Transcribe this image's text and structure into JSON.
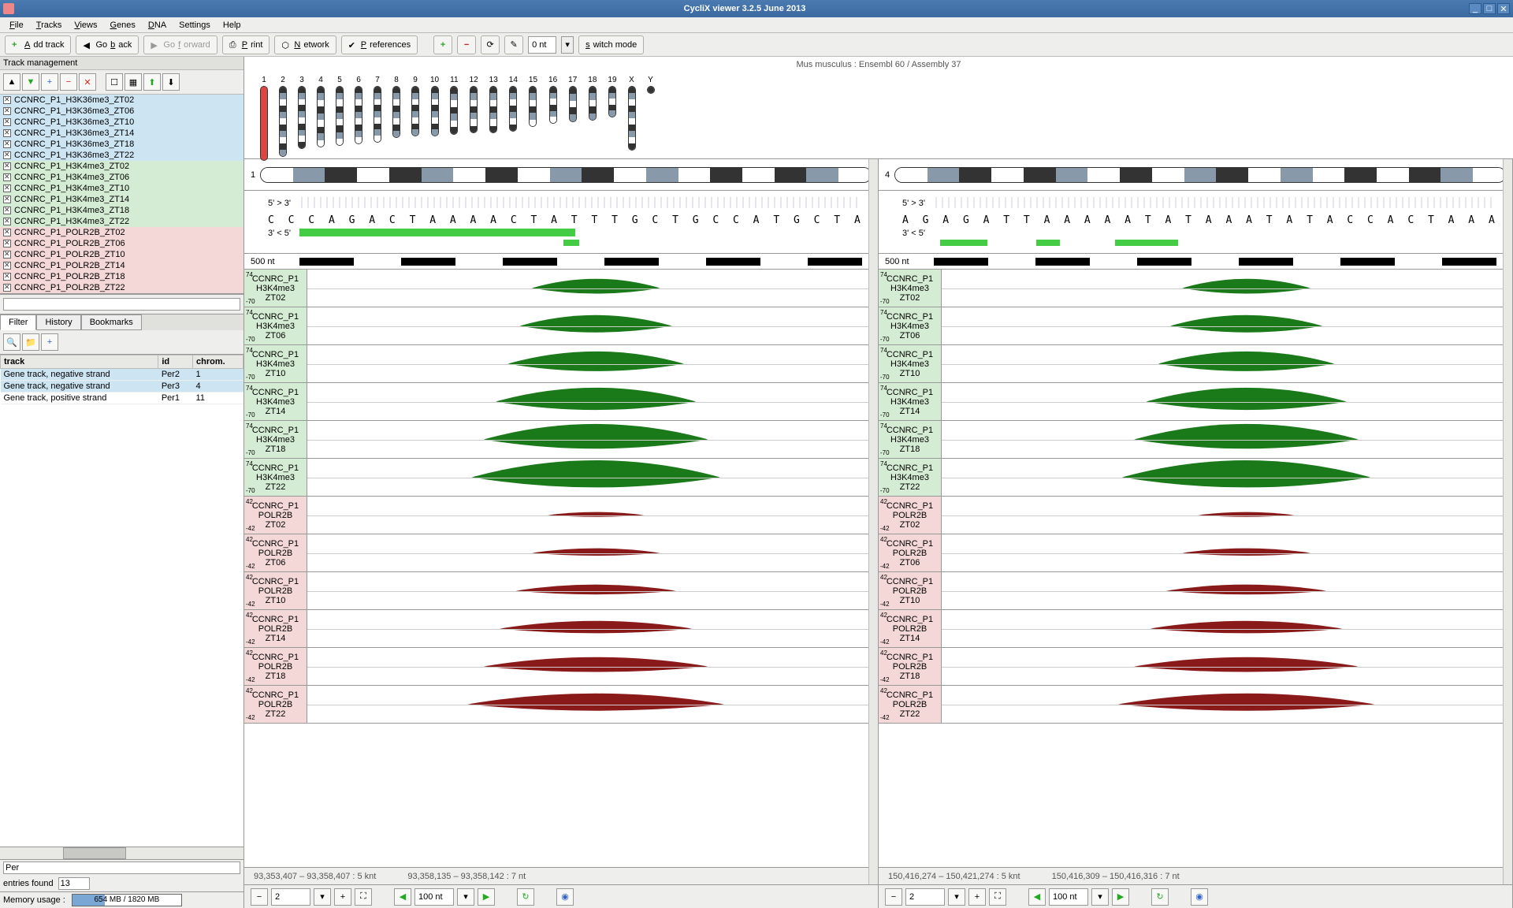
{
  "window": {
    "title": "CycliX viewer 3.2.5 June 2013"
  },
  "menu": {
    "file": "File",
    "tracks": "Tracks",
    "views": "Views",
    "genes": "Genes",
    "dna": "DNA",
    "settings": "Settings",
    "help": "Help"
  },
  "toolbar": {
    "add_track": "Add track",
    "go_back": "Go back",
    "go_forward": "Go forward",
    "print": "Print",
    "network": "Network",
    "preferences": "Preferences",
    "nt_value": "0 nt",
    "switch_mode": "switch mode"
  },
  "left": {
    "header": "Track management",
    "tracks": [
      {
        "name": "CCNRC_P1_H3K36me3_ZT02",
        "g": "blue"
      },
      {
        "name": "CCNRC_P1_H3K36me3_ZT06",
        "g": "blue"
      },
      {
        "name": "CCNRC_P1_H3K36me3_ZT10",
        "g": "blue"
      },
      {
        "name": "CCNRC_P1_H3K36me3_ZT14",
        "g": "blue"
      },
      {
        "name": "CCNRC_P1_H3K36me3_ZT18",
        "g": "blue"
      },
      {
        "name": "CCNRC_P1_H3K36me3_ZT22",
        "g": "blue"
      },
      {
        "name": "CCNRC_P1_H3K4me3_ZT02",
        "g": "green"
      },
      {
        "name": "CCNRC_P1_H3K4me3_ZT06",
        "g": "green"
      },
      {
        "name": "CCNRC_P1_H3K4me3_ZT10",
        "g": "green"
      },
      {
        "name": "CCNRC_P1_H3K4me3_ZT14",
        "g": "green"
      },
      {
        "name": "CCNRC_P1_H3K4me3_ZT18",
        "g": "green"
      },
      {
        "name": "CCNRC_P1_H3K4me3_ZT22",
        "g": "green"
      },
      {
        "name": "CCNRC_P1_POLR2B_ZT02",
        "g": "pink"
      },
      {
        "name": "CCNRC_P1_POLR2B_ZT06",
        "g": "pink"
      },
      {
        "name": "CCNRC_P1_POLR2B_ZT10",
        "g": "pink"
      },
      {
        "name": "CCNRC_P1_POLR2B_ZT14",
        "g": "pink"
      },
      {
        "name": "CCNRC_P1_POLR2B_ZT18",
        "g": "pink"
      },
      {
        "name": "CCNRC_P1_POLR2B_ZT22",
        "g": "pink"
      }
    ],
    "tabs": {
      "filter": "Filter",
      "history": "History",
      "bookmarks": "Bookmarks"
    },
    "table": {
      "cols": {
        "track": "track",
        "id": "id",
        "chrom": "chrom."
      },
      "rows": [
        {
          "track": "Gene track, negative strand",
          "id": "Per2",
          "chrom": "1",
          "sel": true
        },
        {
          "track": "Gene track, negative strand",
          "id": "Per3",
          "chrom": "4",
          "sel": true
        },
        {
          "track": "Gene track, positive strand",
          "id": "Per1",
          "chrom": "11",
          "sel": false
        }
      ]
    },
    "filter_value": "Per",
    "entries_label": "entries found",
    "entries_value": "13",
    "memory_label": "Memory usage :",
    "memory_value": "654 MB / 1820 MB"
  },
  "viewer": {
    "assembly": "Mus musculus : Ensembl 60 / Assembly 37",
    "chrom_labels": [
      "1",
      "2",
      "3",
      "4",
      "5",
      "6",
      "7",
      "8",
      "9",
      "10",
      "11",
      "12",
      "13",
      "14",
      "15",
      "16",
      "17",
      "18",
      "19",
      "X",
      "Y"
    ],
    "chrom_heights": [
      95,
      90,
      80,
      78,
      76,
      74,
      72,
      66,
      64,
      64,
      62,
      60,
      60,
      58,
      52,
      48,
      46,
      44,
      40,
      82,
      10
    ],
    "left_pane": {
      "chrom": "1",
      "seq_5_3": "5' > 3'",
      "seq_3_5": "3' < 5'",
      "sequence": "C C C A G A C T A A A A C T A T T T G C T G C C A T G C T A T G C A A G A A G A G A T T G A A G C A T C A A",
      "green_left": 0,
      "green_width": 350,
      "ruler": "500 nt",
      "status1": "93,353,407 – 93,358,407 : 5 knt",
      "status2": "93,358,135 – 93,358,142 : 7 nt"
    },
    "right_pane": {
      "chrom": "4",
      "seq_5_3": "5' > 3'",
      "seq_3_5": "3' < 5'",
      "sequence": "A G A G A T T A A A A A T A T A A A T A T A C C A C T A A A T T C T C T T C T A A A A T G T C A C T A C A",
      "green_left": 0,
      "green_width": 720,
      "ruler": "500 nt",
      "status1": "150,416,274 – 150,421,274 : 5 knt",
      "status2": "150,416,309 – 150,416,316 : 7 nt"
    },
    "data_tracks": [
      {
        "label": "CCNRC_P1 H3K4me3 ZT02",
        "g": "green",
        "ymax": "74",
        "ymin": "-70"
      },
      {
        "label": "CCNRC_P1 H3K4me3 ZT06",
        "g": "green",
        "ymax": "74",
        "ymin": "-70"
      },
      {
        "label": "CCNRC_P1 H3K4me3 ZT10",
        "g": "green",
        "ymax": "74",
        "ymin": "-70"
      },
      {
        "label": "CCNRC_P1 H3K4me3 ZT14",
        "g": "green",
        "ymax": "74",
        "ymin": "-70"
      },
      {
        "label": "CCNRC_P1 H3K4me3 ZT18",
        "g": "green",
        "ymax": "74",
        "ymin": "-70"
      },
      {
        "label": "CCNRC_P1 H3K4me3 ZT22",
        "g": "green",
        "ymax": "74",
        "ymin": "-70"
      },
      {
        "label": "CCNRC_P1 POLR2B ZT02",
        "g": "pink",
        "ymax": "42",
        "ymin": "-42"
      },
      {
        "label": "CCNRC_P1 POLR2B ZT06",
        "g": "pink",
        "ymax": "42",
        "ymin": "-42"
      },
      {
        "label": "CCNRC_P1 POLR2B ZT10",
        "g": "pink",
        "ymax": "42",
        "ymin": "-42"
      },
      {
        "label": "CCNRC_P1 POLR2B ZT14",
        "g": "pink",
        "ymax": "42",
        "ymin": "-42"
      },
      {
        "label": "CCNRC_P1 POLR2B ZT18",
        "g": "pink",
        "ymax": "42",
        "ymin": "-42"
      },
      {
        "label": "CCNRC_P1 POLR2B ZT22",
        "g": "pink",
        "ymax": "42",
        "ymin": "-42"
      }
    ]
  },
  "nav": {
    "page": "2",
    "zoom": "100 nt"
  }
}
